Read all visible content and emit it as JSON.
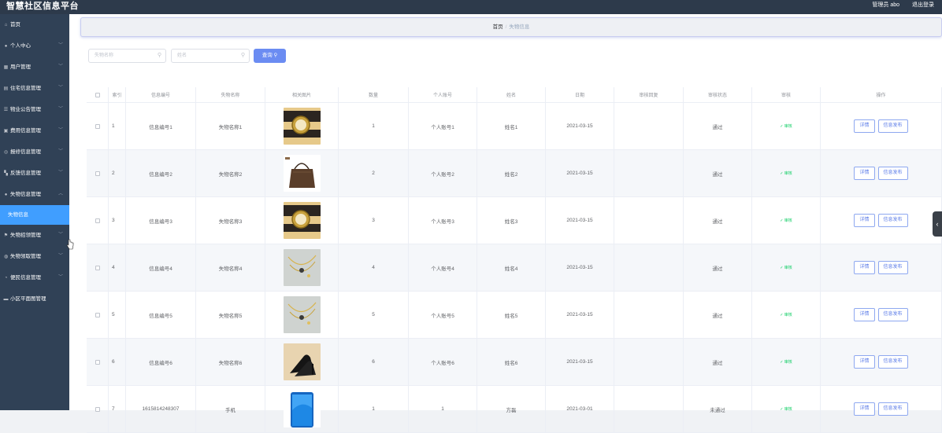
{
  "app": {
    "title": "智慧社区信息平台",
    "user": "管理员 abo",
    "logout": "退出登录"
  },
  "sidebar": {
    "items": [
      {
        "label": "首页",
        "icon": "home-icon",
        "chevron": false
      },
      {
        "label": "个人中心",
        "icon": "user-icon",
        "chevron": true
      },
      {
        "label": "用户管理",
        "icon": "users-icon",
        "chevron": true
      },
      {
        "label": "住宅信息管理",
        "icon": "house-icon",
        "chevron": true
      },
      {
        "label": "物业公告管理",
        "icon": "notice-icon",
        "chevron": true
      },
      {
        "label": "费用信息管理",
        "icon": "fee-icon",
        "chevron": true
      },
      {
        "label": "报修信息管理",
        "icon": "repair-icon",
        "chevron": true
      },
      {
        "label": "反馈信息管理",
        "icon": "feedback-icon",
        "chevron": true
      },
      {
        "label": "失物信息管理",
        "icon": "lost-icon",
        "chevron": true,
        "expanded": true,
        "sub": [
          {
            "label": "失物信息",
            "active": true
          }
        ]
      },
      {
        "label": "失物招领管理",
        "icon": "flag-icon",
        "chevron": true
      },
      {
        "label": "失物领取管理",
        "icon": "claim-icon",
        "chevron": true
      },
      {
        "label": "便民信息管理",
        "icon": "info-icon",
        "chevron": true
      },
      {
        "label": "小区平面图管理",
        "icon": "map-icon",
        "chevron": false
      }
    ]
  },
  "breadcrumb": {
    "home": "首页",
    "sep": "/",
    "current": "失物信息"
  },
  "search": {
    "name_placeholder": "失物名称",
    "person_placeholder": "姓名",
    "button": "查询"
  },
  "table": {
    "headers": [
      "索引",
      "信息编号",
      "失物名称",
      "相关图片",
      "数量",
      "个人账号",
      "姓名",
      "日期",
      "审核回复",
      "审核状态",
      "审核",
      "操作"
    ],
    "rows": [
      {
        "index": "1",
        "code": "信息编号1",
        "name": "失物名称1",
        "image": "watch",
        "qty": "1",
        "account": "个人账号1",
        "person": "姓名1",
        "date": "2021-03-15",
        "reply": "",
        "status": "通过",
        "audit": "审核"
      },
      {
        "index": "2",
        "code": "信息编号2",
        "name": "失物名称2",
        "image": "handbag",
        "qty": "2",
        "account": "个人账号2",
        "person": "姓名2",
        "date": "2021-03-15",
        "reply": "",
        "status": "通过",
        "audit": "审核"
      },
      {
        "index": "3",
        "code": "信息编号3",
        "name": "失物名称3",
        "image": "watch",
        "qty": "3",
        "account": "个人账号3",
        "person": "姓名3",
        "date": "2021-03-15",
        "reply": "",
        "status": "通过",
        "audit": "审核"
      },
      {
        "index": "4",
        "code": "信息编号4",
        "name": "失物名称4",
        "image": "necklace",
        "qty": "4",
        "account": "个人账号4",
        "person": "姓名4",
        "date": "2021-03-15",
        "reply": "",
        "status": "通过",
        "audit": "审核"
      },
      {
        "index": "5",
        "code": "信息编号5",
        "name": "失物名称5",
        "image": "necklace",
        "qty": "5",
        "account": "个人账号5",
        "person": "姓名5",
        "date": "2021-03-15",
        "reply": "",
        "status": "通过",
        "audit": "审核"
      },
      {
        "index": "6",
        "code": "信息编号6",
        "name": "失物名称6",
        "image": "shoes",
        "qty": "6",
        "account": "个人账号6",
        "person": "姓名6",
        "date": "2021-03-15",
        "reply": "",
        "status": "通过",
        "audit": "审核"
      },
      {
        "index": "7",
        "code": "1615814248307",
        "name": "手机",
        "image": "phone",
        "qty": "1",
        "account": "1",
        "person": "方磊",
        "date": "2021-03-01",
        "reply": "",
        "status": "未通过",
        "audit": "审核"
      }
    ],
    "actions": {
      "detail": "详情",
      "publish": "信息发布"
    }
  },
  "colors": {
    "topbar": "#2d3a4b",
    "sidebar": "#304156",
    "active": "#409eff",
    "primary_button": "#6b8cf2",
    "audit_green": "#13ce66"
  }
}
